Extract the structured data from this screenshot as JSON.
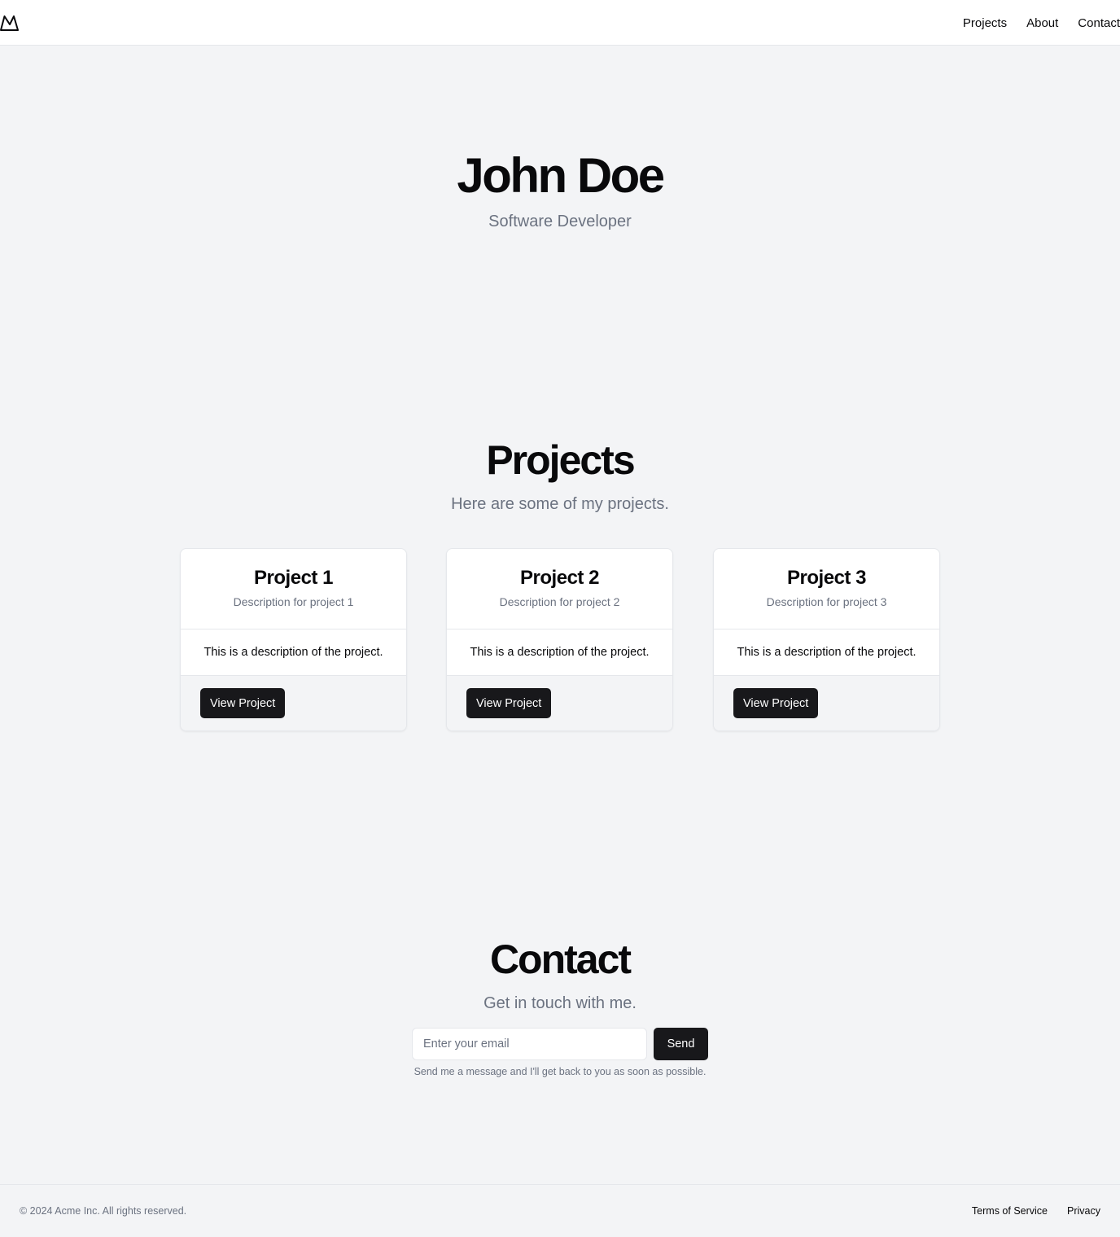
{
  "header": {
    "logo_icon": "mountain-icon",
    "nav": [
      "Projects",
      "About",
      "Contact"
    ]
  },
  "hero": {
    "name": "John Doe",
    "role": "Software Developer"
  },
  "projects": {
    "title": "Projects",
    "subtitle": "Here are some of my projects.",
    "items": [
      {
        "title": "Project 1",
        "description": "Description for project 1",
        "body": "This is a description of the project.",
        "button": "View Project"
      },
      {
        "title": "Project 2",
        "description": "Description for project 2",
        "body": "This is a description of the project.",
        "button": "View Project"
      },
      {
        "title": "Project 3",
        "description": "Description for project 3",
        "body": "This is a description of the project.",
        "button": "View Project"
      }
    ]
  },
  "contact": {
    "title": "Contact",
    "subtitle": "Get in touch with me.",
    "email_placeholder": "Enter your email",
    "email_value": "",
    "send_label": "Send",
    "note": "Send me a message and I'll get back to you as soon as possible."
  },
  "footer": {
    "copyright": "© 2024 Acme Inc. All rights reserved.",
    "links": [
      "Terms of Service",
      "Privacy"
    ]
  },
  "colors": {
    "background": "#f3f4f6",
    "surface": "#ffffff",
    "primary": "#18181b",
    "muted_text": "#6b7280",
    "border": "#e5e7eb"
  }
}
